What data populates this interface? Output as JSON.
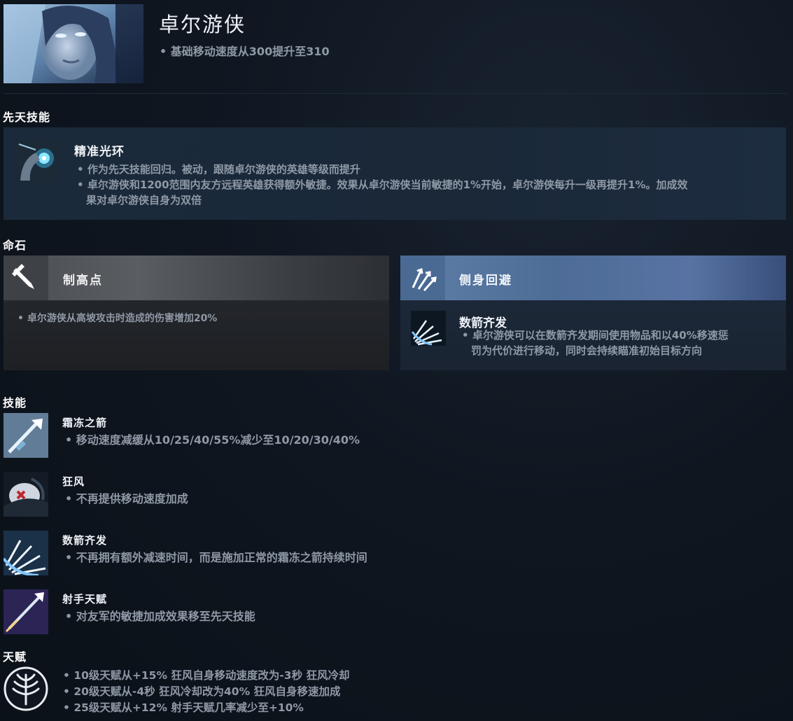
{
  "header": {
    "hero_name": "卓尔游侠",
    "hero_change": "基础移动速度从300提升至310"
  },
  "innate": {
    "section_title": "先天技能",
    "name": "精准光环",
    "bullet1": "作为先天技能回归。被动，跟随卓尔游侠的英雄等级而提升",
    "bullet2_line1": "卓尔游侠和1200范围内友方远程英雄获得额外敏捷。效果从卓尔游侠当前敏捷的1%开始，卓尔游侠每升一级再提升1%。加成效",
    "bullet2_line2": "果对卓尔游侠自身为双倍"
  },
  "facets": {
    "section_title": "命石",
    "facet1": {
      "title": "制高点",
      "desc": "卓尔游侠从高坡攻击时造成的伤害增加20%",
      "icon": "sword-icon",
      "color": "#4a4d52"
    },
    "facet2": {
      "title": "侧身回避",
      "ability_name": "数箭齐发",
      "desc_line1": "卓尔游侠可以在数箭齐发期间使用物品和以40%移速惩",
      "desc_line2": "罚为代价进行移动，同时会持续瞄准初始目标方向",
      "icon": "arrows-icon",
      "color": "#5f7fa8"
    }
  },
  "abilities": {
    "section_title": "技能",
    "items": [
      {
        "name": "霜冻之箭",
        "desc": "移动速度减缓从10/25/40/55%减少至10/20/30/40%",
        "icon": "frost-arrow-icon"
      },
      {
        "name": "狂风",
        "desc": "不再提供移动速度加成",
        "icon": "gust-icon"
      },
      {
        "name": "数箭齐发",
        "desc": "不再拥有额外减速时间，而是施加正常的霜冻之箭持续时间",
        "icon": "multishot-icon"
      },
      {
        "name": "射手天赋",
        "desc": "对友军的敏捷加成效果移至先天技能",
        "icon": "marksmanship-icon"
      }
    ]
  },
  "talents": {
    "section_title": "天赋",
    "icon": "talent-tree-icon",
    "lines": [
      "10级天赋从+15% 狂风自身移动速度改为-3秒 狂风冷却",
      "20级天赋从-4秒 狂风冷却改为40% 狂风自身移速加成",
      "25级天赋从+12% 射手天赋几率减少至+10%"
    ]
  }
}
